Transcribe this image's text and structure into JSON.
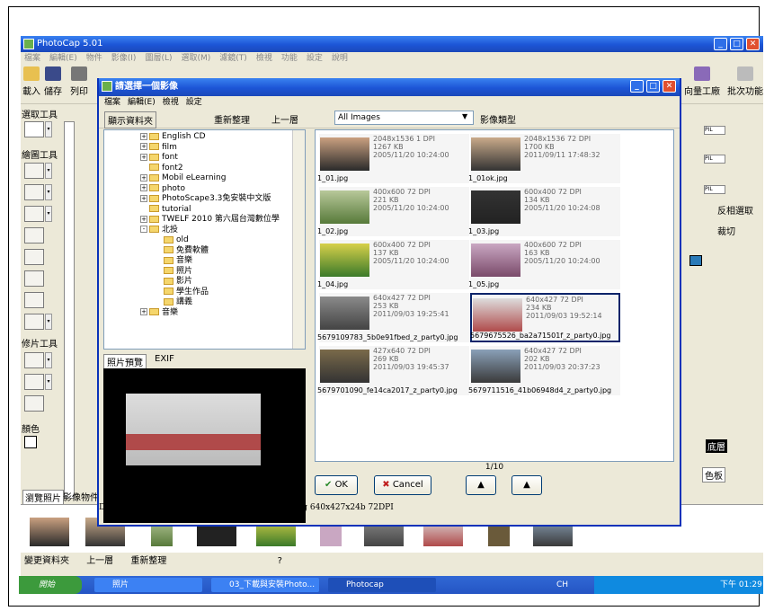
{
  "app": {
    "title": "PhotoCap 5.01",
    "menu": [
      "檔案",
      "編輯(E)",
      "物件",
      "影像(I)",
      "圖層(L)",
      "選取(M)",
      "濾鏡(T)",
      "檢視",
      "功能",
      "設定",
      "說明"
    ],
    "toolbar": {
      "load": "載入",
      "save": "儲存",
      "print": "列印",
      "volume_factory": "向量工廠",
      "batch": "批次功能"
    },
    "left": {
      "select_tools": "選取工具",
      "draw_tools": "繪圖工具",
      "retouch_tools": "修片工具",
      "color": "顏色"
    },
    "right": {
      "px": "PIL",
      "invert": "反相選取",
      "crop": "裁切",
      "layer": "底層",
      "color_plate": "色板"
    },
    "tabs": {
      "browse": "瀏覽照片",
      "objects": "影像物件"
    },
    "bottom": [
      "變更資料夾",
      "上一層",
      "重新整理",
      "?"
    ]
  },
  "dialog": {
    "title": "請選擇一個影像",
    "menu": [
      "檔案",
      "編輯(E)",
      "檢視",
      "設定"
    ],
    "show_folders": "顯示資料夾",
    "refresh": "重新整理",
    "up": "上一層",
    "filter": "All Images",
    "filter_label": "影像類型",
    "tree": [
      {
        "label": "English CD",
        "pm": "+",
        "indent": 0
      },
      {
        "label": "film",
        "pm": "+",
        "indent": 0
      },
      {
        "label": "font",
        "pm": "+",
        "indent": 0
      },
      {
        "label": "font2",
        "pm": "",
        "indent": 0
      },
      {
        "label": "Mobil eLearning",
        "pm": "+",
        "indent": 0
      },
      {
        "label": "photo",
        "pm": "+",
        "indent": 0
      },
      {
        "label": "PhotoScape3.3免安裝中文版",
        "pm": "+",
        "indent": 0
      },
      {
        "label": "tutorial",
        "pm": "",
        "indent": 0
      },
      {
        "label": "TWELF 2010 第六屆台灣數位學",
        "pm": "+",
        "indent": 0
      },
      {
        "label": "北投",
        "pm": "-",
        "indent": 0
      },
      {
        "label": "old",
        "pm": "",
        "indent": 1
      },
      {
        "label": "免費軟體",
        "pm": "",
        "indent": 1
      },
      {
        "label": "音樂",
        "pm": "",
        "indent": 1
      },
      {
        "label": "照片",
        "pm": "",
        "indent": 1
      },
      {
        "label": "影片",
        "pm": "",
        "indent": 1
      },
      {
        "label": "學生作品",
        "pm": "",
        "indent": 1
      },
      {
        "label": "講義",
        "pm": "",
        "indent": 1
      },
      {
        "label": "音樂",
        "pm": "+",
        "indent": 0
      }
    ],
    "preview_tabs": [
      "照片預覽",
      "EXIF"
    ],
    "images": [
      {
        "dims": "2048x1536 1 DPI",
        "size": "1267 KB",
        "date": "2005/11/20 10:24:00",
        "name": "1_01.jpg",
        "c1": "#caa080",
        "c2": "#2a2a2a"
      },
      {
        "dims": "2048x1536 72 DPI",
        "size": "1700 KB",
        "date": "2011/09/11 17:48:32",
        "name": "1_01ok.jpg",
        "c1": "#c9aa8a",
        "c2": "#333"
      },
      {
        "dims": "400x600 72 DPI",
        "size": "221 KB",
        "date": "2005/11/20 10:24:00",
        "name": "1_02.jpg",
        "c1": "#b8c89a",
        "c2": "#577a3a"
      },
      {
        "dims": "600x400 72 DPI",
        "size": "134 KB",
        "date": "2005/11/20 10:24:08",
        "name": "1_03.jpg",
        "c1": "#333",
        "c2": "#222"
      },
      {
        "dims": "600x400 72 DPI",
        "size": "137 KB",
        "date": "2005/11/20 10:24:00",
        "name": "1_04.jpg",
        "c1": "#d7d04a",
        "c2": "#3b7a2a"
      },
      {
        "dims": "400x600 72 DPI",
        "size": "163 KB",
        "date": "2005/11/20 10:24:00",
        "name": "1_05.jpg",
        "c1": "#c9a7c2",
        "c2": "#7a4a6a"
      },
      {
        "dims": "640x427 72 DPI",
        "size": "253 KB",
        "date": "2011/09/03 19:25:41",
        "name": "5679109783_5b0e91fbed_z_party0.jpg",
        "c1": "#8a8a8a",
        "c2": "#444"
      },
      {
        "dims": "640x427 72 DPI",
        "size": "234 KB",
        "date": "2011/09/03 19:52:14",
        "name": "5679675526_ba2a71501f_z_party0.jpg",
        "c1": "#ddd",
        "c2": "#b04a4a"
      },
      {
        "dims": "427x640 72 DPI",
        "size": "269 KB",
        "date": "2011/09/03 19:45:37",
        "name": "5679701090_fe14ca2017_z_party0.jpg",
        "c1": "#7a6a4a",
        "c2": "#333"
      },
      {
        "dims": "640x427 72 DPI",
        "size": "202 KB",
        "date": "2011/09/03 20:37:23",
        "name": "5679711516_41b06948d4_z_party0.jpg",
        "c1": "#8aa0b8",
        "c2": "#3a3a3a"
      }
    ],
    "page": "1/10",
    "ok": "OK",
    "cancel": "Cancel",
    "status": "D:\\北投\\照片\\5679675526_ba2a71501f_z_party0.jpg  640x427x24b  72DPI"
  },
  "taskbar": {
    "start": "開始",
    "tasks": [
      "照片",
      "03_下載與安裝Photo...",
      "Photocap"
    ],
    "ime": "CH",
    "clock": "下午 01:29"
  }
}
